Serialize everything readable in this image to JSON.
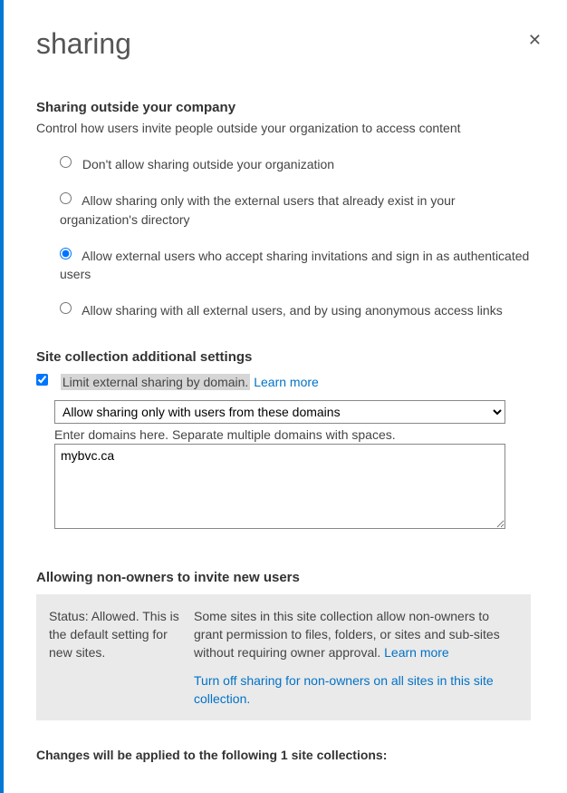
{
  "title": "sharing",
  "close_symbol": "✕",
  "outside": {
    "title": "Sharing outside your company",
    "desc": "Control how users invite people outside your organization to access content",
    "options": [
      "Don't allow sharing outside your organization",
      "Allow sharing only with the external users that already exist in your organization's directory",
      "Allow external users who accept sharing invitations and sign in as authenticated users",
      "Allow sharing with all external users, and by using anonymous access links"
    ]
  },
  "additional": {
    "title": "Site collection additional settings",
    "checkbox_label": "Limit external sharing by domain.",
    "learn_more": "Learn more",
    "select_value": "Allow sharing only with users from these domains",
    "hint": "Enter domains here. Separate multiple domains with spaces.",
    "domains_value": "mybvc.ca"
  },
  "nonowners": {
    "title": "Allowing non-owners to invite new users",
    "status": "Status: Allowed. This is the default setting for new sites.",
    "explanation": "Some sites in this site collection allow non-owners to grant permission to files, folders, or sites and sub-sites without requiring owner approval. ",
    "learn_more": "Learn more",
    "turn_off_link": "Turn off sharing for non-owners on all sites in this site collection."
  },
  "footer": "Changes will be applied to the following 1 site collections:"
}
